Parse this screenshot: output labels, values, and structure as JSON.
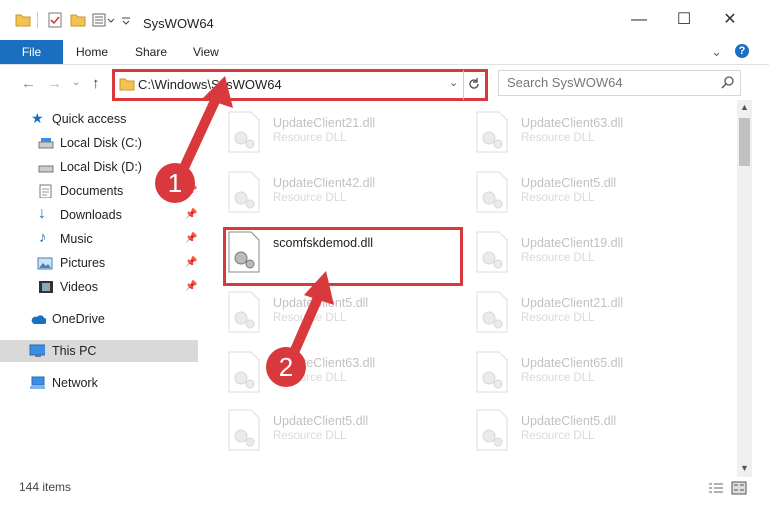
{
  "window": {
    "title": "SysWOW64",
    "minimize_glyph": "—",
    "maximize_glyph": "☐",
    "close_glyph": "✕"
  },
  "ribbon": {
    "file_tab": "File",
    "tabs": [
      "Home",
      "Share",
      "View"
    ]
  },
  "nav": {
    "address": "C:\\Windows\\SysWOW64",
    "search_placeholder": "Search SysWOW64"
  },
  "sidebar": {
    "items": [
      {
        "label": "Quick access",
        "icon": "star-icon",
        "pinned": false
      },
      {
        "label": "Local Disk (C:)",
        "icon": "drive-icon",
        "pinned": false
      },
      {
        "label": "Local Disk (D:)",
        "icon": "drive-icon",
        "pinned": false
      },
      {
        "label": "Documents",
        "icon": "documents-icon",
        "pinned": true
      },
      {
        "label": "Downloads",
        "icon": "download-icon",
        "pinned": true
      },
      {
        "label": "Music",
        "icon": "music-icon",
        "pinned": true
      },
      {
        "label": "Pictures",
        "icon": "pictures-icon",
        "pinned": true
      },
      {
        "label": "Videos",
        "icon": "videos-icon",
        "pinned": true
      },
      {
        "label": "OneDrive",
        "icon": "cloud-icon",
        "pinned": false
      },
      {
        "label": "This PC",
        "icon": "computer-icon",
        "pinned": false,
        "selected": true
      },
      {
        "label": "Network",
        "icon": "network-icon",
        "pinned": false
      }
    ]
  },
  "files": [
    {
      "name": "UpdateClient21.dll",
      "type": "Resource DLL",
      "faded": true
    },
    {
      "name": "UpdateClient63.dll",
      "type": "Resource DLL",
      "faded": true
    },
    {
      "name": "UpdateClient42.dll",
      "type": "Resource DLL",
      "faded": true
    },
    {
      "name": "UpdateClient5.dll",
      "type": "Resource DLL",
      "faded": true
    },
    {
      "name": "scomfskdemod.dll",
      "type": "",
      "faded": false
    },
    {
      "name": "UpdateClient19.dll",
      "type": "Resource DLL",
      "faded": true
    },
    {
      "name": "UpdateClient5.dll",
      "type": "Resource DLL",
      "faded": true
    },
    {
      "name": "UpdateClient21.dll",
      "type": "Resource DLL",
      "faded": true
    },
    {
      "name": "UpdateClient63.dll",
      "type": "Resource DLL",
      "faded": true
    },
    {
      "name": "UpdateClient65.dll",
      "type": "Resource DLL",
      "faded": true
    },
    {
      "name": "UpdateClient5.dll",
      "type": "Resource DLL",
      "faded": true
    },
    {
      "name": "UpdateClient5.dll",
      "type": "Resource DLL",
      "faded": true
    }
  ],
  "status": {
    "item_count": "144 items"
  },
  "annotations": {
    "badge1": "1",
    "badge2": "2",
    "accent": "#d9393d"
  },
  "colors": {
    "file_tab": "#1a6fc1",
    "selected_row": "#d9d9d9"
  }
}
